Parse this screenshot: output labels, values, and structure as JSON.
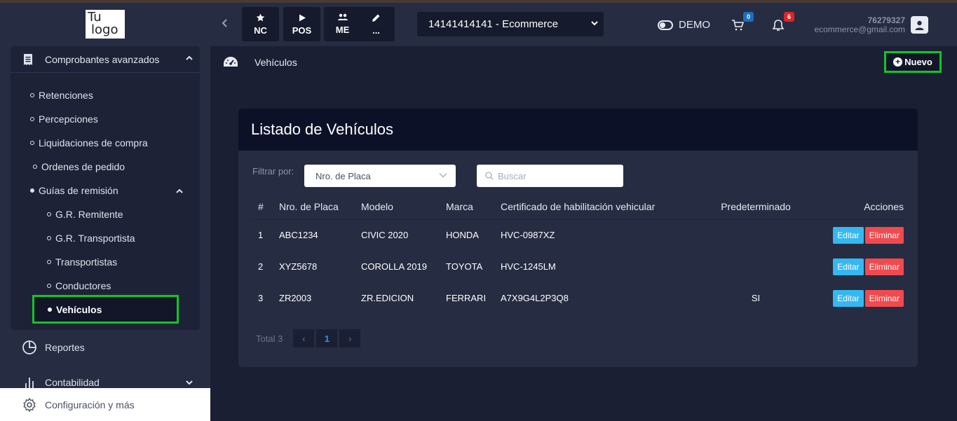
{
  "logo": {
    "line1": "Tu",
    "line2": "logo"
  },
  "sidebar": {
    "section_title": "Comprobantes avanzados",
    "items": [
      {
        "label": "Retenciones"
      },
      {
        "label": "Percepciones"
      },
      {
        "label": "Liquidaciones de compra"
      },
      {
        "label": "Ordenes de pedido"
      },
      {
        "label": "Guías de remisión"
      }
    ],
    "sub_items": [
      {
        "label": "G.R. Remitente"
      },
      {
        "label": "G.R. Transportista"
      },
      {
        "label": "Transportistas"
      },
      {
        "label": "Conductores"
      }
    ],
    "active_item": "Vehículos",
    "reports": "Reportes",
    "accounting": "Contabilidad",
    "config": "Configuración y más"
  },
  "topbar": {
    "quick_buttons": [
      {
        "label": "NC",
        "icon": "star-icon"
      },
      {
        "label": "POS",
        "icon": "play-icon"
      },
      {
        "label": "ME",
        "icon": "users-icon"
      },
      {
        "label": "...",
        "icon": "pencil-icon"
      }
    ],
    "company": "14141414141 - Ecommerce",
    "demo_label": "DEMO",
    "cart_count": "0",
    "notifications_count": "6",
    "user_number": "76279327",
    "user_email": "ecommerce@gmail.com"
  },
  "page": {
    "breadcrumb": "Vehículos",
    "new_button": "Nuevo",
    "card_title": "Listado de Vehículos",
    "filter_label": "Filtrar por:",
    "filter_value": "Nro. de Placa",
    "search_placeholder": "Buscar"
  },
  "table": {
    "headers": {
      "num": "#",
      "plate": "Nro. de Placa",
      "model": "Modelo",
      "brand": "Marca",
      "cert": "Certificado de habilitación vehicular",
      "default": "Predeterminado",
      "actions": "Acciones"
    },
    "rows": [
      {
        "num": "1",
        "plate": "ABC1234",
        "model": "CIVIC 2020",
        "brand": "HONDA",
        "cert": "HVC-0987XZ",
        "default": ""
      },
      {
        "num": "2",
        "plate": "XYZ5678",
        "model": "COROLLA 2019",
        "brand": "TOYOTA",
        "cert": "HVC-1245LM",
        "default": ""
      },
      {
        "num": "3",
        "plate": "ZR2003",
        "model": "ZR.EDICION",
        "brand": "FERRARI",
        "cert": "A7X9G4L2P3Q8",
        "default": "SI"
      }
    ],
    "edit_label": "Editar",
    "delete_label": "Eliminar"
  },
  "pagination": {
    "total": "Total 3",
    "current_page": "1",
    "prev": "‹",
    "next": "›"
  },
  "colors": {
    "highlight": "#16c226",
    "edit": "#35b8f0",
    "delete": "#f04a4f",
    "background": "#1b1f33",
    "panel": "#262c41"
  }
}
